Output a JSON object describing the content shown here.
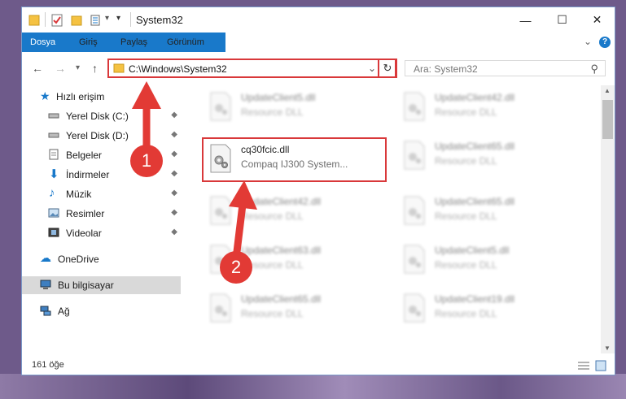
{
  "window": {
    "title": "System32",
    "quick_access_dropdown": "▾",
    "minimize": "—",
    "maximize": "☐",
    "close": "✕"
  },
  "ribbon": {
    "tabs": [
      "Dosya",
      "Giriş",
      "Paylaş",
      "Görünüm"
    ],
    "expand": "⌄",
    "help": "?"
  },
  "nav": {
    "back": "←",
    "forward": "→",
    "recent": "▾",
    "up": "↑",
    "address": "C:\\Windows\\System32",
    "address_dropdown": "⌄",
    "refresh": "↻",
    "search_placeholder": "Ara: System32",
    "search_icon": "⚲"
  },
  "sidebar": {
    "items": [
      {
        "label": "Hızlı erişim",
        "icon": "star-icon",
        "pinned": false
      },
      {
        "label": "Yerel Disk (C:)",
        "icon": "drive-icon",
        "pinned": true
      },
      {
        "label": "Yerel Disk (D:)",
        "icon": "drive-icon",
        "pinned": true
      },
      {
        "label": "Belgeler",
        "icon": "documents-icon",
        "pinned": true
      },
      {
        "label": "İndirmeler",
        "icon": "download-icon",
        "pinned": true
      },
      {
        "label": "Müzik",
        "icon": "music-icon",
        "pinned": true
      },
      {
        "label": "Resimler",
        "icon": "pictures-icon",
        "pinned": true
      },
      {
        "label": "Videolar",
        "icon": "videos-icon",
        "pinned": true
      },
      {
        "label": "OneDrive",
        "icon": "cloud-icon",
        "pinned": false
      },
      {
        "label": "Bu bilgisayar",
        "icon": "computer-icon",
        "pinned": false,
        "selected": true
      },
      {
        "label": "Ağ",
        "icon": "network-icon",
        "pinned": false
      }
    ],
    "pin_glyph": "📌"
  },
  "files": {
    "left": [
      {
        "name": "UpdateClient5.dll",
        "desc": "Resource DLL",
        "blurred": true
      },
      {
        "name": "cq30fcic.dll",
        "desc": "Compaq IJ300 System...",
        "blurred": false
      },
      {
        "name": "UpdateClient42.dll",
        "desc": "Resource DLL",
        "blurred": true
      },
      {
        "name": "UpdateClient63.dll",
        "desc": "Resource DLL",
        "blurred": true
      },
      {
        "name": "UpdateClient65.dll",
        "desc": "Resource DLL",
        "blurred": true
      }
    ],
    "right": [
      {
        "name": "UpdateClient42.dll",
        "desc": "Resource DLL",
        "blurred": true
      },
      {
        "name": "UpdateClient65.dll",
        "desc": "Resource DLL",
        "blurred": true
      },
      {
        "name": "UpdateClient65.dll",
        "desc": "Resource DLL",
        "blurred": true
      },
      {
        "name": "UpdateClient5.dll",
        "desc": "Resource DLL",
        "blurred": true
      },
      {
        "name": "UpdateClient19.dll",
        "desc": "Resource DLL",
        "blurred": true
      }
    ]
  },
  "status": {
    "count": "161 öğe"
  },
  "annotations": {
    "step1": "1",
    "step2": "2"
  },
  "colors": {
    "accent": "#1979ca",
    "highlight": "#d9383a",
    "selected": "#d9d9d9"
  }
}
